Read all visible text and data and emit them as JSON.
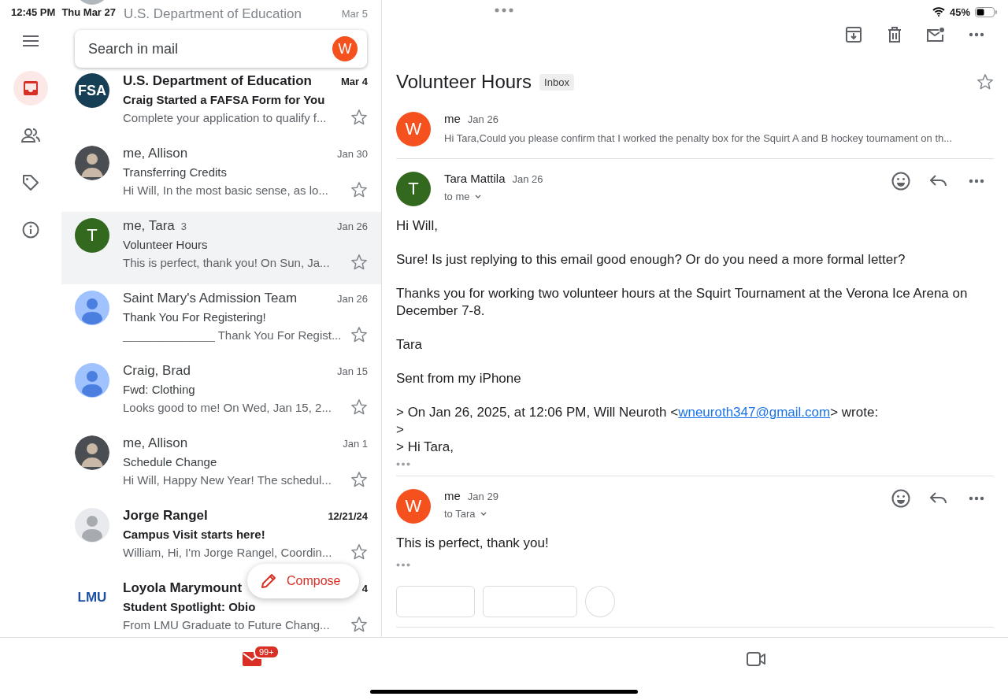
{
  "status_bar": {
    "time": "12:45 PM",
    "date": "Thu Mar 27",
    "battery": "45%"
  },
  "behind_search": {
    "sender": "U.S. Department of Education",
    "date": "Mar 5"
  },
  "search": {
    "placeholder": "Search in mail",
    "account_letter": "W"
  },
  "rail": [
    {
      "selected": false
    },
    {
      "selected": true
    },
    {
      "selected": false
    },
    {
      "selected": false
    },
    {
      "selected": false
    }
  ],
  "emails": [
    {
      "avatar": {
        "kind": "logo",
        "text": "FSA",
        "color": "#163e54"
      },
      "sender": "U.S. Department of Education",
      "date": "Mar 4",
      "subject": "Craig Started a FAFSA Form for You",
      "snippet": "Complete your application to qualify f...",
      "unread": true,
      "selected": false,
      "starred": false
    },
    {
      "avatar": {
        "kind": "photo"
      },
      "sender": "me, Allison",
      "date": "Jan 30",
      "subject": "Transferring Credits",
      "snippet": "Hi Will, In the most basic sense, as lo...",
      "unread": false,
      "selected": false,
      "starred": false
    },
    {
      "avatar": {
        "kind": "letter",
        "text": "T",
        "color": "#33691e"
      },
      "sender": "me, Tara",
      "count": "3",
      "date": "Jan 26",
      "subject": "Volunteer Hours",
      "snippet": "This is perfect, thank you! On Sun, Ja...",
      "unread": false,
      "selected": true,
      "starred": false
    },
    {
      "avatar": {
        "kind": "person",
        "color": "#a0c3ff"
      },
      "sender": "Saint Mary's Admission Team",
      "date": "Jan 26",
      "subject": "Thank You For Registering!",
      "snippet": "______________ Thank You For Regist...",
      "unread": false,
      "selected": false,
      "starred": false
    },
    {
      "avatar": {
        "kind": "person",
        "color": "#a0c3ff"
      },
      "sender": "Craig, Brad",
      "date": "Jan 15",
      "subject": "Fwd: Clothing",
      "snippet": "Looks good to me! On Wed, Jan 15, 2...",
      "unread": false,
      "selected": false,
      "starred": false
    },
    {
      "avatar": {
        "kind": "photo"
      },
      "sender": "me, Allison",
      "date": "Jan 1",
      "subject": "Schedule Change",
      "snippet": "Hi Will, Happy New Year! The schedul...",
      "unread": false,
      "selected": false,
      "starred": false
    },
    {
      "avatar": {
        "kind": "person",
        "color": "#e8eaed"
      },
      "sender": "Jorge Rangel",
      "date": "12/21/24",
      "subject": "Campus Visit starts here!",
      "snippet": "William, Hi, I'm Jorge Rangel, Coordin...",
      "unread": true,
      "selected": false,
      "starred": false
    },
    {
      "avatar": {
        "kind": "logo",
        "text": "LMU",
        "color": "#ffffff"
      },
      "sender": "Loyola Marymount",
      "date": "4",
      "subject": "Student Spotlight: Obio",
      "snippet": "From LMU Graduate to Future Chang...",
      "unread": true,
      "selected": false,
      "starred": false
    }
  ],
  "compose": {
    "label": "Compose"
  },
  "thread": {
    "title": "Volunteer Hours",
    "label": "Inbox",
    "starred": false,
    "messages": [
      {
        "kind": "collapsed",
        "avatar": {
          "text": "W",
          "color": "#f4511e"
        },
        "sender": "me",
        "date": "Jan 26",
        "snippet": "Hi Tara,Could you please confirm that I worked the penalty box for the Squirt A and B hockey tournament on th..."
      },
      {
        "kind": "expanded",
        "avatar": {
          "text": "T",
          "color": "#33691e"
        },
        "sender": "Tara Mattila",
        "date": "Jan 26",
        "recipient": "to me",
        "body": [
          {
            "kind": "para",
            "text": "Hi Will,"
          },
          {
            "kind": "para",
            "text": "Sure! Is just replying to this email good enough? Or do you need a more formal letter?"
          },
          {
            "kind": "para",
            "text": "Thanks you for working two volunteer hours at the Squirt Tournament at the Verona Ice Arena on December 7-8."
          },
          {
            "kind": "para",
            "text": "Tara"
          },
          {
            "kind": "para",
            "text": "Sent from my iPhone"
          },
          {
            "kind": "quote",
            "pre": "> On Jan 26, 2025, at 12:06 PM, Will Neuroth <",
            "link": "wneuroth347@gmail.com",
            "post": "> wrote:"
          },
          {
            "kind": "quote",
            "pre": ">"
          },
          {
            "kind": "quote",
            "pre": "> Hi Tara,"
          }
        ]
      },
      {
        "kind": "expanded",
        "avatar": {
          "text": "W",
          "color": "#f4511e"
        },
        "sender": "me",
        "date": "Jan 29",
        "recipient": "to Tara",
        "body": [
          {
            "kind": "para",
            "text": "This is perfect, thank you!"
          }
        ],
        "actions": true
      }
    ]
  },
  "bottom_nav": [
    {
      "badge": "99+",
      "selected": true
    },
    {
      "selected": false
    }
  ]
}
